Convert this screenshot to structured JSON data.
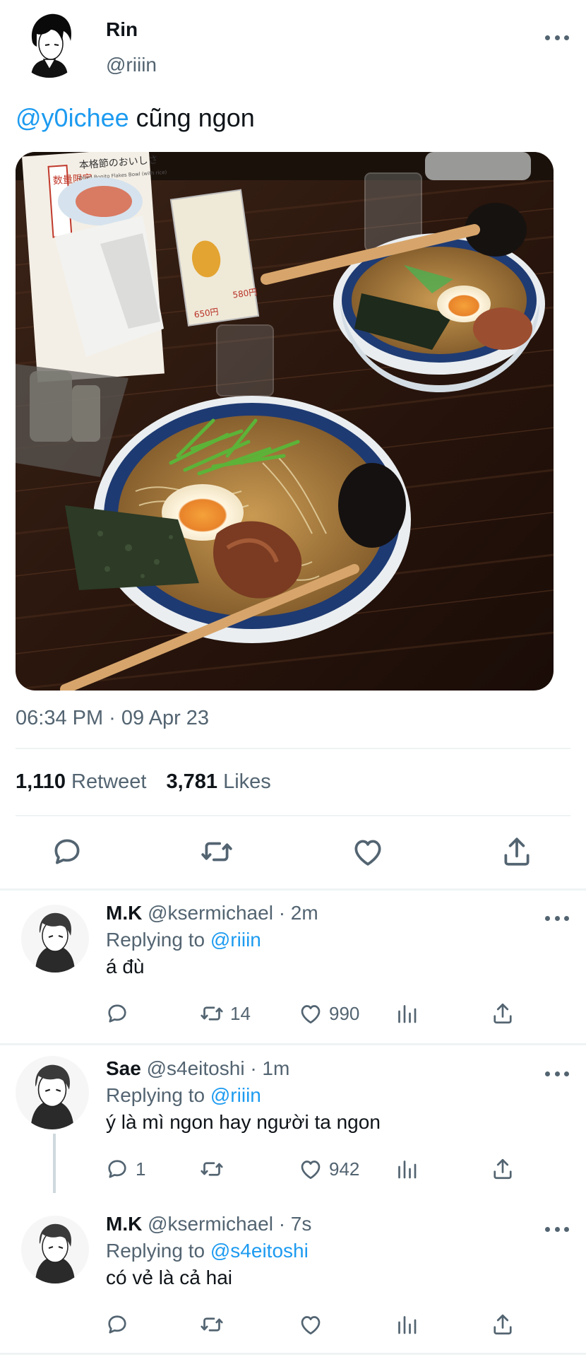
{
  "tweet": {
    "author_name": "Rin",
    "author_handle": "@riiin",
    "mention": "@y0ichee",
    "text": " cũng ngon",
    "timestamp": "06:34 PM · 09 Apr 23",
    "retweet_count": "1,110",
    "retweet_label": "Retweet",
    "likes_count": "3,781",
    "likes_label": "Likes",
    "media_signs": {
      "menu_left": "数量限定",
      "menu_top": "本格節のおいしさ",
      "menu_sub": "Dried Bonito Flakes Bowl (with rice)",
      "price_1": "650円",
      "price_2": "580円"
    }
  },
  "replies": [
    {
      "name": "M.K",
      "handle": "@ksermichael",
      "time": " · 2m",
      "replying_label": "Replying to ",
      "replying_to": "@riiin",
      "text": "á đù",
      "reply_count": "",
      "retweet_count": "14",
      "like_count": "990"
    },
    {
      "name": "Sae",
      "handle": "@s4eitoshi",
      "time": " · 1m",
      "replying_label": "Replying to ",
      "replying_to": "@riiin",
      "text": "ý là mì ngon hay người ta ngon",
      "reply_count": "1",
      "retweet_count": "",
      "like_count": "942"
    },
    {
      "name": "M.K",
      "handle": "@ksermichael",
      "time": " · 7s",
      "replying_label": "Replying to ",
      "replying_to": "@s4eitoshi",
      "text": "có vẻ là cả hai",
      "reply_count": "",
      "retweet_count": "",
      "like_count": ""
    }
  ],
  "icons": {
    "reply": "speech-bubble-icon",
    "retweet": "retweet-arrows-icon",
    "like": "heart-icon",
    "share": "upload-share-icon",
    "analytics": "bar-chart-icon",
    "more": "ellipsis-icon"
  },
  "colors": {
    "link": "#1d9bf0",
    "muted": "#536471",
    "text": "#0f1419",
    "divider": "#eff3f4"
  }
}
